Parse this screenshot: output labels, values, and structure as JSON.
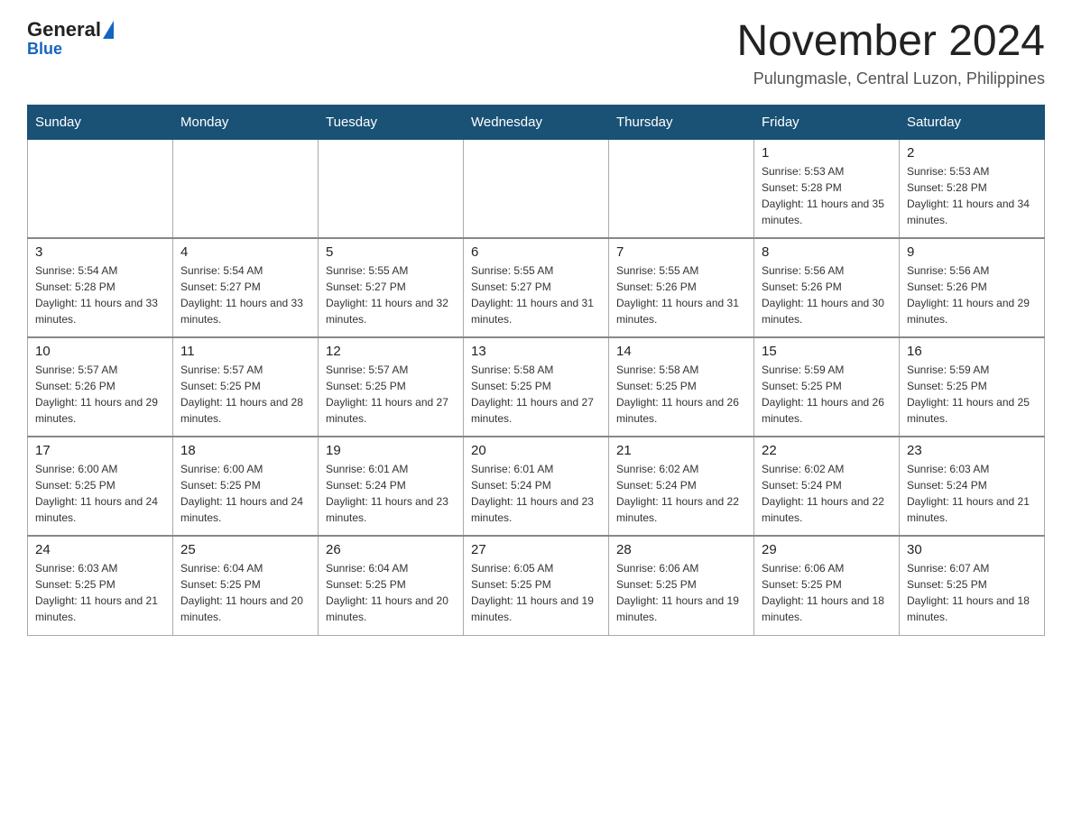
{
  "logo": {
    "text1": "General",
    "text2": "Blue"
  },
  "header": {
    "month_year": "November 2024",
    "location": "Pulungmasle, Central Luzon, Philippines"
  },
  "weekdays": [
    "Sunday",
    "Monday",
    "Tuesday",
    "Wednesday",
    "Thursday",
    "Friday",
    "Saturday"
  ],
  "weeks": [
    [
      {
        "day": "",
        "sunrise": "",
        "sunset": "",
        "daylight": ""
      },
      {
        "day": "",
        "sunrise": "",
        "sunset": "",
        "daylight": ""
      },
      {
        "day": "",
        "sunrise": "",
        "sunset": "",
        "daylight": ""
      },
      {
        "day": "",
        "sunrise": "",
        "sunset": "",
        "daylight": ""
      },
      {
        "day": "",
        "sunrise": "",
        "sunset": "",
        "daylight": ""
      },
      {
        "day": "1",
        "sunrise": "Sunrise: 5:53 AM",
        "sunset": "Sunset: 5:28 PM",
        "daylight": "Daylight: 11 hours and 35 minutes."
      },
      {
        "day": "2",
        "sunrise": "Sunrise: 5:53 AM",
        "sunset": "Sunset: 5:28 PM",
        "daylight": "Daylight: 11 hours and 34 minutes."
      }
    ],
    [
      {
        "day": "3",
        "sunrise": "Sunrise: 5:54 AM",
        "sunset": "Sunset: 5:28 PM",
        "daylight": "Daylight: 11 hours and 33 minutes."
      },
      {
        "day": "4",
        "sunrise": "Sunrise: 5:54 AM",
        "sunset": "Sunset: 5:27 PM",
        "daylight": "Daylight: 11 hours and 33 minutes."
      },
      {
        "day": "5",
        "sunrise": "Sunrise: 5:55 AM",
        "sunset": "Sunset: 5:27 PM",
        "daylight": "Daylight: 11 hours and 32 minutes."
      },
      {
        "day": "6",
        "sunrise": "Sunrise: 5:55 AM",
        "sunset": "Sunset: 5:27 PM",
        "daylight": "Daylight: 11 hours and 31 minutes."
      },
      {
        "day": "7",
        "sunrise": "Sunrise: 5:55 AM",
        "sunset": "Sunset: 5:26 PM",
        "daylight": "Daylight: 11 hours and 31 minutes."
      },
      {
        "day": "8",
        "sunrise": "Sunrise: 5:56 AM",
        "sunset": "Sunset: 5:26 PM",
        "daylight": "Daylight: 11 hours and 30 minutes."
      },
      {
        "day": "9",
        "sunrise": "Sunrise: 5:56 AM",
        "sunset": "Sunset: 5:26 PM",
        "daylight": "Daylight: 11 hours and 29 minutes."
      }
    ],
    [
      {
        "day": "10",
        "sunrise": "Sunrise: 5:57 AM",
        "sunset": "Sunset: 5:26 PM",
        "daylight": "Daylight: 11 hours and 29 minutes."
      },
      {
        "day": "11",
        "sunrise": "Sunrise: 5:57 AM",
        "sunset": "Sunset: 5:25 PM",
        "daylight": "Daylight: 11 hours and 28 minutes."
      },
      {
        "day": "12",
        "sunrise": "Sunrise: 5:57 AM",
        "sunset": "Sunset: 5:25 PM",
        "daylight": "Daylight: 11 hours and 27 minutes."
      },
      {
        "day": "13",
        "sunrise": "Sunrise: 5:58 AM",
        "sunset": "Sunset: 5:25 PM",
        "daylight": "Daylight: 11 hours and 27 minutes."
      },
      {
        "day": "14",
        "sunrise": "Sunrise: 5:58 AM",
        "sunset": "Sunset: 5:25 PM",
        "daylight": "Daylight: 11 hours and 26 minutes."
      },
      {
        "day": "15",
        "sunrise": "Sunrise: 5:59 AM",
        "sunset": "Sunset: 5:25 PM",
        "daylight": "Daylight: 11 hours and 26 minutes."
      },
      {
        "day": "16",
        "sunrise": "Sunrise: 5:59 AM",
        "sunset": "Sunset: 5:25 PM",
        "daylight": "Daylight: 11 hours and 25 minutes."
      }
    ],
    [
      {
        "day": "17",
        "sunrise": "Sunrise: 6:00 AM",
        "sunset": "Sunset: 5:25 PM",
        "daylight": "Daylight: 11 hours and 24 minutes."
      },
      {
        "day": "18",
        "sunrise": "Sunrise: 6:00 AM",
        "sunset": "Sunset: 5:25 PM",
        "daylight": "Daylight: 11 hours and 24 minutes."
      },
      {
        "day": "19",
        "sunrise": "Sunrise: 6:01 AM",
        "sunset": "Sunset: 5:24 PM",
        "daylight": "Daylight: 11 hours and 23 minutes."
      },
      {
        "day": "20",
        "sunrise": "Sunrise: 6:01 AM",
        "sunset": "Sunset: 5:24 PM",
        "daylight": "Daylight: 11 hours and 23 minutes."
      },
      {
        "day": "21",
        "sunrise": "Sunrise: 6:02 AM",
        "sunset": "Sunset: 5:24 PM",
        "daylight": "Daylight: 11 hours and 22 minutes."
      },
      {
        "day": "22",
        "sunrise": "Sunrise: 6:02 AM",
        "sunset": "Sunset: 5:24 PM",
        "daylight": "Daylight: 11 hours and 22 minutes."
      },
      {
        "day": "23",
        "sunrise": "Sunrise: 6:03 AM",
        "sunset": "Sunset: 5:24 PM",
        "daylight": "Daylight: 11 hours and 21 minutes."
      }
    ],
    [
      {
        "day": "24",
        "sunrise": "Sunrise: 6:03 AM",
        "sunset": "Sunset: 5:25 PM",
        "daylight": "Daylight: 11 hours and 21 minutes."
      },
      {
        "day": "25",
        "sunrise": "Sunrise: 6:04 AM",
        "sunset": "Sunset: 5:25 PM",
        "daylight": "Daylight: 11 hours and 20 minutes."
      },
      {
        "day": "26",
        "sunrise": "Sunrise: 6:04 AM",
        "sunset": "Sunset: 5:25 PM",
        "daylight": "Daylight: 11 hours and 20 minutes."
      },
      {
        "day": "27",
        "sunrise": "Sunrise: 6:05 AM",
        "sunset": "Sunset: 5:25 PM",
        "daylight": "Daylight: 11 hours and 19 minutes."
      },
      {
        "day": "28",
        "sunrise": "Sunrise: 6:06 AM",
        "sunset": "Sunset: 5:25 PM",
        "daylight": "Daylight: 11 hours and 19 minutes."
      },
      {
        "day": "29",
        "sunrise": "Sunrise: 6:06 AM",
        "sunset": "Sunset: 5:25 PM",
        "daylight": "Daylight: 11 hours and 18 minutes."
      },
      {
        "day": "30",
        "sunrise": "Sunrise: 6:07 AM",
        "sunset": "Sunset: 5:25 PM",
        "daylight": "Daylight: 11 hours and 18 minutes."
      }
    ]
  ]
}
